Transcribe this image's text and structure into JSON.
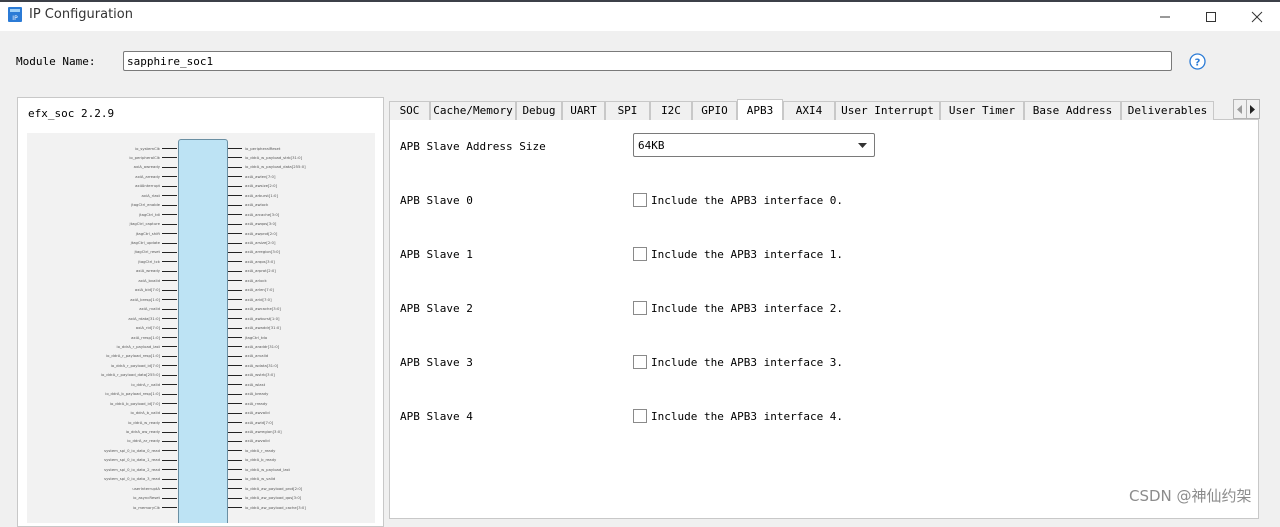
{
  "window": {
    "title": "IP Configuration",
    "app_icon_text": "IP"
  },
  "module": {
    "label": "Module Name:",
    "value": "sapphire_soc1"
  },
  "ip": {
    "version": "efx_soc 2.2.9"
  },
  "diagram": {
    "left_pins": [
      "io_systemClk",
      "io_peripheralClk",
      "axiA_awready",
      "axiA_arready",
      "axiAInterrupt",
      "axiA_rlast",
      "jtagCtrl_enable",
      "jtagCtrl_tdi",
      "jtagCtrl_capture",
      "jtagCtrl_shift",
      "jtagCtrl_update",
      "jtagCtrl_reset",
      "jtagCtrl_tck",
      "axiA_wready",
      "axiA_bvalid",
      "axiA_bid[7:0]",
      "axiA_bresp[1:0]",
      "axiA_rvalid",
      "axiA_rdata[31:0]",
      "axiA_rid[7:0]",
      "axiA_rresp[1:0]",
      "io_ddrA_r_payload_last",
      "io_ddrA_r_payload_resp[1:0]",
      "io_ddrA_r_payload_id[7:0]",
      "io_ddrA_r_payload_data[255:0]",
      "io_ddrA_r_valid",
      "io_ddrA_b_payload_resp[1:0]",
      "io_ddrA_b_payload_id[7:0]",
      "io_ddrA_b_valid",
      "io_ddrA_w_ready",
      "io_ddrA_aw_ready",
      "io_ddrA_ar_ready",
      "system_spi_0_io_data_0_read",
      "system_spi_0_io_data_1_read",
      "system_spi_0_io_data_2_read",
      "system_spi_0_io_data_3_read",
      "userInterruptA",
      "io_asyncReset",
      "io_memoryClk"
    ],
    "right_pins": [
      "io_peripheralReset",
      "io_ddrA_w_payload_strb[31:0]",
      "io_ddrA_w_payload_data[255:0]",
      "axiA_awlen[7:0]",
      "axiA_awsize[2:0]",
      "axiA_arburst[1:0]",
      "axiA_awlock",
      "axiA_arcache[3:0]",
      "axiA_awqos[3:0]",
      "axiA_awprot[2:0]",
      "axiA_arsize[2:0]",
      "axiA_arregion[3:0]",
      "axiA_arqos[3:0]",
      "axiA_arprot[2:0]",
      "axiA_arlock",
      "axiA_arlen[7:0]",
      "axiA_arid[7:0]",
      "axiA_awcache[3:0]",
      "axiA_awburst[1:0]",
      "axiA_awaddr[31:0]",
      "jtagCtrl_tdo",
      "axiA_araddr[31:0]",
      "axiA_arvalid",
      "axiA_wdata[31:0]",
      "axiA_wstrb[3:0]",
      "axiA_wlast",
      "axiA_bready",
      "axiA_rready",
      "axiA_awvalid",
      "axiA_awid[7:0]",
      "axiA_awregion[3:0]",
      "axiA_awvalid",
      "io_ddrA_r_ready",
      "io_ddrA_b_ready",
      "io_ddrA_w_payload_last",
      "io_ddrA_w_valid",
      "io_ddrA_aw_payload_prot[2:0]",
      "io_ddrA_aw_payload_qos[3:0]",
      "io_ddrA_aw_payload_cache[3:0]"
    ]
  },
  "tabs": [
    {
      "label": "SOC",
      "active": false
    },
    {
      "label": "Cache/Memory",
      "active": false
    },
    {
      "label": "Debug",
      "active": false
    },
    {
      "label": "UART",
      "active": false
    },
    {
      "label": "SPI",
      "active": false
    },
    {
      "label": "I2C",
      "active": false
    },
    {
      "label": "GPIO",
      "active": false
    },
    {
      "label": "APB3",
      "active": true
    },
    {
      "label": "AXI4",
      "active": false
    },
    {
      "label": "User Interrupt",
      "active": false
    },
    {
      "label": "User Timer",
      "active": false
    },
    {
      "label": "Base Address",
      "active": false
    },
    {
      "label": "Deliverables",
      "active": false
    }
  ],
  "apb3": {
    "address_size_label": "APB Slave Address Size",
    "address_size_value": "64KB",
    "slaves": [
      {
        "label": "APB Slave 0",
        "checkbox_label": "Include the APB3 interface 0.",
        "checked": false
      },
      {
        "label": "APB Slave 1",
        "checkbox_label": "Include the APB3 interface 1.",
        "checked": false
      },
      {
        "label": "APB Slave 2",
        "checkbox_label": "Include the APB3 interface 2.",
        "checked": false
      },
      {
        "label": "APB Slave 3",
        "checkbox_label": "Include the APB3 interface 3.",
        "checked": false
      },
      {
        "label": "APB Slave 4",
        "checkbox_label": "Include the APB3 interface 4.",
        "checked": false
      }
    ]
  },
  "watermark": "CSDN @神仙约架",
  "colors": {
    "accent": "#2b7bd6",
    "core_fill": "#bde3f4",
    "window_bg": "#f0f0f0"
  }
}
